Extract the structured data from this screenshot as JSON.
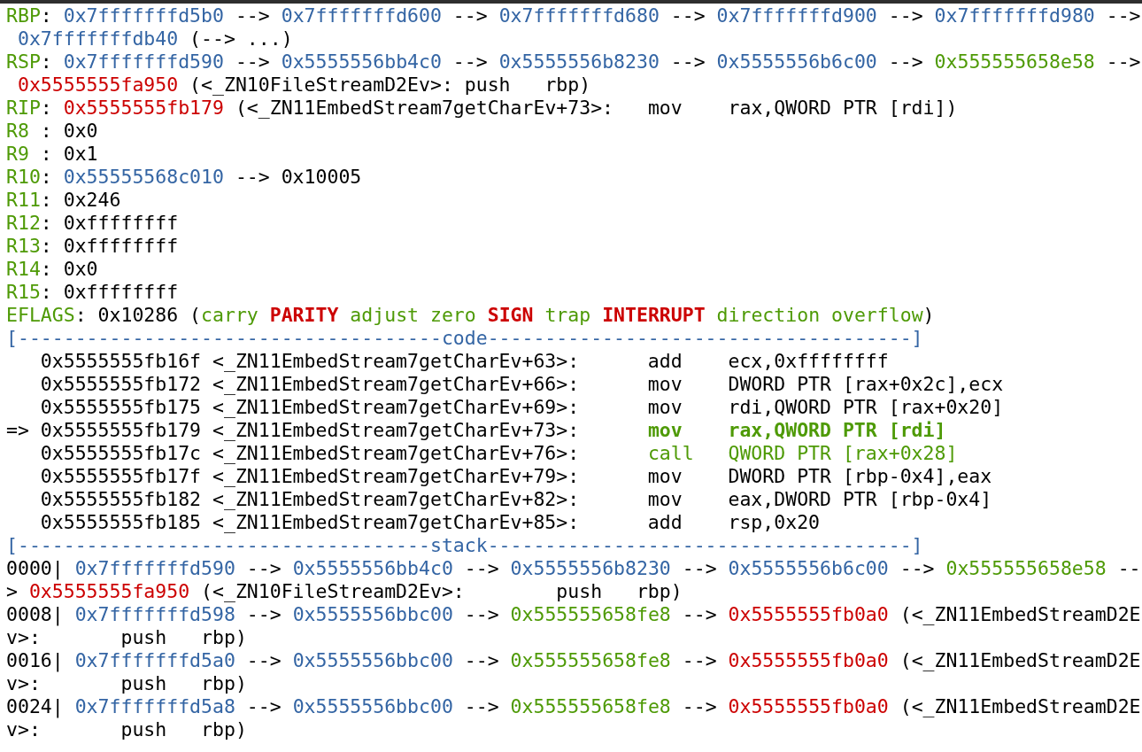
{
  "lines": [
    {
      "segments": [
        {
          "text": "RBP",
          "color": "#4e9a06"
        },
        {
          "text": ": ",
          "color": "#000000"
        },
        {
          "text": "0x7fffffffd5b0",
          "color": "#3465a4"
        },
        {
          "text": " --> ",
          "color": "#000000"
        },
        {
          "text": "0x7fffffffd600",
          "color": "#3465a4"
        },
        {
          "text": " --> ",
          "color": "#000000"
        },
        {
          "text": "0x7fffffffd680",
          "color": "#3465a4"
        },
        {
          "text": " --> ",
          "color": "#000000"
        },
        {
          "text": "0x7fffffffd900",
          "color": "#3465a4"
        },
        {
          "text": " --> ",
          "color": "#000000"
        },
        {
          "text": "0x7fffffffd980",
          "color": "#3465a4"
        },
        {
          "text": " -->",
          "color": "#000000"
        }
      ]
    },
    {
      "segments": [
        {
          "text": " 0x7fffffffdb40",
          "color": "#3465a4"
        },
        {
          "text": " (--> ...)",
          "color": "#000000"
        }
      ]
    },
    {
      "segments": [
        {
          "text": "RSP",
          "color": "#4e9a06"
        },
        {
          "text": ": ",
          "color": "#000000"
        },
        {
          "text": "0x7fffffffd590",
          "color": "#3465a4"
        },
        {
          "text": " --> ",
          "color": "#000000"
        },
        {
          "text": "0x5555556bb4c0",
          "color": "#3465a4"
        },
        {
          "text": " --> ",
          "color": "#000000"
        },
        {
          "text": "0x5555556b8230",
          "color": "#3465a4"
        },
        {
          "text": " --> ",
          "color": "#000000"
        },
        {
          "text": "0x5555556b6c00",
          "color": "#3465a4"
        },
        {
          "text": " --> ",
          "color": "#000000"
        },
        {
          "text": "0x555555658e58",
          "color": "#4e9a06"
        },
        {
          "text": " -->",
          "color": "#000000"
        }
      ]
    },
    {
      "segments": [
        {
          "text": " 0x5555555fa950",
          "color": "#cc0000"
        },
        {
          "text": " (<_ZN10FileStreamD2Ev>: push   rbp)",
          "color": "#000000"
        }
      ]
    },
    {
      "segments": [
        {
          "text": "RIP",
          "color": "#4e9a06"
        },
        {
          "text": ": ",
          "color": "#000000"
        },
        {
          "text": "0x5555555fb179",
          "color": "#cc0000"
        },
        {
          "text": " (<_ZN11EmbedStream7getCharEv+73>:   mov    rax,QWORD PTR [rdi])",
          "color": "#000000"
        }
      ]
    },
    {
      "segments": [
        {
          "text": "R8",
          "color": "#4e9a06"
        },
        {
          "text": " : 0x0",
          "color": "#000000"
        }
      ]
    },
    {
      "segments": [
        {
          "text": "R9",
          "color": "#4e9a06"
        },
        {
          "text": " : 0x1",
          "color": "#000000"
        }
      ]
    },
    {
      "segments": [
        {
          "text": "R10",
          "color": "#4e9a06"
        },
        {
          "text": ": ",
          "color": "#000000"
        },
        {
          "text": "0x55555568c010",
          "color": "#3465a4"
        },
        {
          "text": " --> 0x10005",
          "color": "#000000"
        }
      ]
    },
    {
      "segments": [
        {
          "text": "R11",
          "color": "#4e9a06"
        },
        {
          "text": ": 0x246",
          "color": "#000000"
        }
      ]
    },
    {
      "segments": [
        {
          "text": "R12",
          "color": "#4e9a06"
        },
        {
          "text": ": 0xffffffff",
          "color": "#000000"
        }
      ]
    },
    {
      "segments": [
        {
          "text": "R13",
          "color": "#4e9a06"
        },
        {
          "text": ": 0xffffffff",
          "color": "#000000"
        }
      ]
    },
    {
      "segments": [
        {
          "text": "R14",
          "color": "#4e9a06"
        },
        {
          "text": ": 0x0",
          "color": "#000000"
        }
      ]
    },
    {
      "segments": [
        {
          "text": "R15",
          "color": "#4e9a06"
        },
        {
          "text": ": 0xffffffff",
          "color": "#000000"
        }
      ]
    },
    {
      "segments": [
        {
          "text": "EFLAGS",
          "color": "#4e9a06"
        },
        {
          "text": ": 0x10286 (",
          "color": "#000000"
        },
        {
          "text": "carry ",
          "color": "#4e9a06"
        },
        {
          "text": "PARITY",
          "color": "#cc0000",
          "bold": true
        },
        {
          "text": " adjust zero ",
          "color": "#4e9a06"
        },
        {
          "text": "SIGN",
          "color": "#cc0000",
          "bold": true
        },
        {
          "text": " trap ",
          "color": "#4e9a06"
        },
        {
          "text": "INTERRUPT",
          "color": "#cc0000",
          "bold": true
        },
        {
          "text": " direction overflow",
          "color": "#4e9a06"
        },
        {
          "text": ")",
          "color": "#000000"
        }
      ]
    },
    {
      "segments": [
        {
          "text": "[-------------------------------------code-------------------------------------]",
          "color": "#3465a4"
        }
      ]
    },
    {
      "segments": [
        {
          "text": "   0x5555555fb16f <_ZN11EmbedStream7getCharEv+63>:      add    ecx,0xffffffff",
          "color": "#000000"
        }
      ]
    },
    {
      "segments": [
        {
          "text": "   0x5555555fb172 <_ZN11EmbedStream7getCharEv+66>:      mov    DWORD PTR [rax+0x2c],ecx",
          "color": "#000000"
        }
      ]
    },
    {
      "segments": [
        {
          "text": "   0x5555555fb175 <_ZN11EmbedStream7getCharEv+69>:      mov    rdi,QWORD PTR [rax+0x20]",
          "color": "#000000"
        }
      ]
    },
    {
      "segments": [
        {
          "text": "=> 0x5555555fb179 <_ZN11EmbedStream7getCharEv+73>:      ",
          "color": "#000000"
        },
        {
          "text": "mov    rax,QWORD PTR [rdi]",
          "color": "#4e9a06",
          "bold": true
        }
      ]
    },
    {
      "segments": [
        {
          "text": "   0x5555555fb17c <_ZN11EmbedStream7getCharEv+76>:      ",
          "color": "#000000"
        },
        {
          "text": "call   QWORD PTR [rax+0x28]",
          "color": "#4e9a06"
        }
      ]
    },
    {
      "segments": [
        {
          "text": "   0x5555555fb17f <_ZN11EmbedStream7getCharEv+79>:      mov    DWORD PTR [rbp-0x4],eax",
          "color": "#000000"
        }
      ]
    },
    {
      "segments": [
        {
          "text": "   0x5555555fb182 <_ZN11EmbedStream7getCharEv+82>:      mov    eax,DWORD PTR [rbp-0x4]",
          "color": "#000000"
        }
      ]
    },
    {
      "segments": [
        {
          "text": "   0x5555555fb185 <_ZN11EmbedStream7getCharEv+85>:      add    rsp,0x20",
          "color": "#000000"
        }
      ]
    },
    {
      "segments": [
        {
          "text": "[------------------------------------stack-------------------------------------]",
          "color": "#3465a4"
        }
      ]
    },
    {
      "segments": [
        {
          "text": "0000| ",
          "color": "#000000"
        },
        {
          "text": "0x7fffffffd590",
          "color": "#3465a4"
        },
        {
          "text": " --> ",
          "color": "#000000"
        },
        {
          "text": "0x5555556bb4c0",
          "color": "#3465a4"
        },
        {
          "text": " --> ",
          "color": "#000000"
        },
        {
          "text": "0x5555556b8230",
          "color": "#3465a4"
        },
        {
          "text": " --> ",
          "color": "#000000"
        },
        {
          "text": "0x5555556b6c00",
          "color": "#3465a4"
        },
        {
          "text": " --> ",
          "color": "#000000"
        },
        {
          "text": "0x555555658e58",
          "color": "#4e9a06"
        },
        {
          "text": " --",
          "color": "#000000"
        }
      ]
    },
    {
      "segments": [
        {
          "text": "> ",
          "color": "#000000"
        },
        {
          "text": "0x5555555fa950",
          "color": "#cc0000"
        },
        {
          "text": " (<_ZN10FileStreamD2Ev>:        push   rbp)",
          "color": "#000000"
        }
      ]
    },
    {
      "segments": [
        {
          "text": "0008| ",
          "color": "#000000"
        },
        {
          "text": "0x7fffffffd598",
          "color": "#3465a4"
        },
        {
          "text": " --> ",
          "color": "#000000"
        },
        {
          "text": "0x5555556bbc00",
          "color": "#3465a4"
        },
        {
          "text": " --> ",
          "color": "#000000"
        },
        {
          "text": "0x555555658fe8",
          "color": "#4e9a06"
        },
        {
          "text": " --> ",
          "color": "#000000"
        },
        {
          "text": "0x5555555fb0a0",
          "color": "#cc0000"
        },
        {
          "text": " (<_ZN11EmbedStreamD2E",
          "color": "#000000"
        }
      ]
    },
    {
      "segments": [
        {
          "text": "v>:       push   rbp)",
          "color": "#000000"
        }
      ]
    },
    {
      "segments": [
        {
          "text": "0016| ",
          "color": "#000000"
        },
        {
          "text": "0x7fffffffd5a0",
          "color": "#3465a4"
        },
        {
          "text": " --> ",
          "color": "#000000"
        },
        {
          "text": "0x5555556bbc00",
          "color": "#3465a4"
        },
        {
          "text": " --> ",
          "color": "#000000"
        },
        {
          "text": "0x555555658fe8",
          "color": "#4e9a06"
        },
        {
          "text": " --> ",
          "color": "#000000"
        },
        {
          "text": "0x5555555fb0a0",
          "color": "#cc0000"
        },
        {
          "text": " (<_ZN11EmbedStreamD2E",
          "color": "#000000"
        }
      ]
    },
    {
      "segments": [
        {
          "text": "v>:       push   rbp)",
          "color": "#000000"
        }
      ]
    },
    {
      "segments": [
        {
          "text": "0024| ",
          "color": "#000000"
        },
        {
          "text": "0x7fffffffd5a8",
          "color": "#3465a4"
        },
        {
          "text": " --> ",
          "color": "#000000"
        },
        {
          "text": "0x5555556bbc00",
          "color": "#3465a4"
        },
        {
          "text": " --> ",
          "color": "#000000"
        },
        {
          "text": "0x555555658fe8",
          "color": "#4e9a06"
        },
        {
          "text": " --> ",
          "color": "#000000"
        },
        {
          "text": "0x5555555fb0a0",
          "color": "#cc0000"
        },
        {
          "text": " (<_ZN11EmbedStreamD2E",
          "color": "#000000"
        }
      ]
    },
    {
      "segments": [
        {
          "text": "v>:       push   rbp)",
          "color": "#000000"
        }
      ]
    }
  ]
}
